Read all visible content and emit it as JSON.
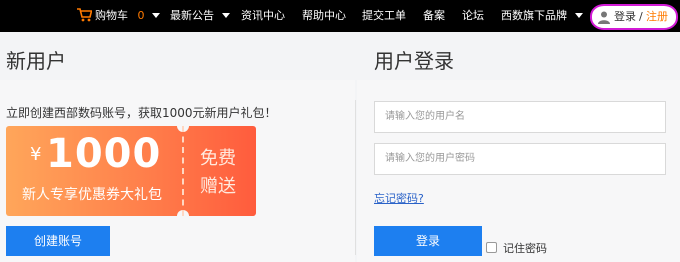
{
  "nav": {
    "cart_label": "购物车",
    "cart_count": "0",
    "items": [
      {
        "label": "最新公告",
        "has_dropdown": true
      },
      {
        "label": "资讯中心",
        "has_dropdown": false
      },
      {
        "label": "帮助中心",
        "has_dropdown": false
      },
      {
        "label": "提交工单",
        "has_dropdown": false
      },
      {
        "label": "备案",
        "has_dropdown": false
      },
      {
        "label": "论坛",
        "has_dropdown": false
      },
      {
        "label": "西数旗下品牌",
        "has_dropdown": true
      }
    ],
    "login_label": "登录",
    "separator": "/",
    "register_label": "注册",
    "icons": {
      "cart": "shopping-cart-icon",
      "user": "user-icon",
      "dropdown": "chevron-down-icon"
    }
  },
  "left": {
    "title": "新用户",
    "promo_text": "立即创建西部数码账号，获取1000元新用户礼包！",
    "coupon": {
      "currency": "¥",
      "amount": "1000",
      "subtitle": "新人专享优惠券大礼包",
      "free_line1": "免费",
      "free_line2": "赠送"
    },
    "create_button": "创建账号"
  },
  "right": {
    "title": "用户登录",
    "username_placeholder": "请输入您的用户名",
    "password_placeholder": "请输入您的用户密码",
    "forgot_label": "忘记密码?",
    "login_button": "登录",
    "remember_label": "记住密码"
  },
  "colors": {
    "nav_bg": "#000000",
    "accent_orange": "#ff7a00",
    "primary_blue": "#1d7ff0",
    "highlight_magenta": "#d21ad6"
  }
}
